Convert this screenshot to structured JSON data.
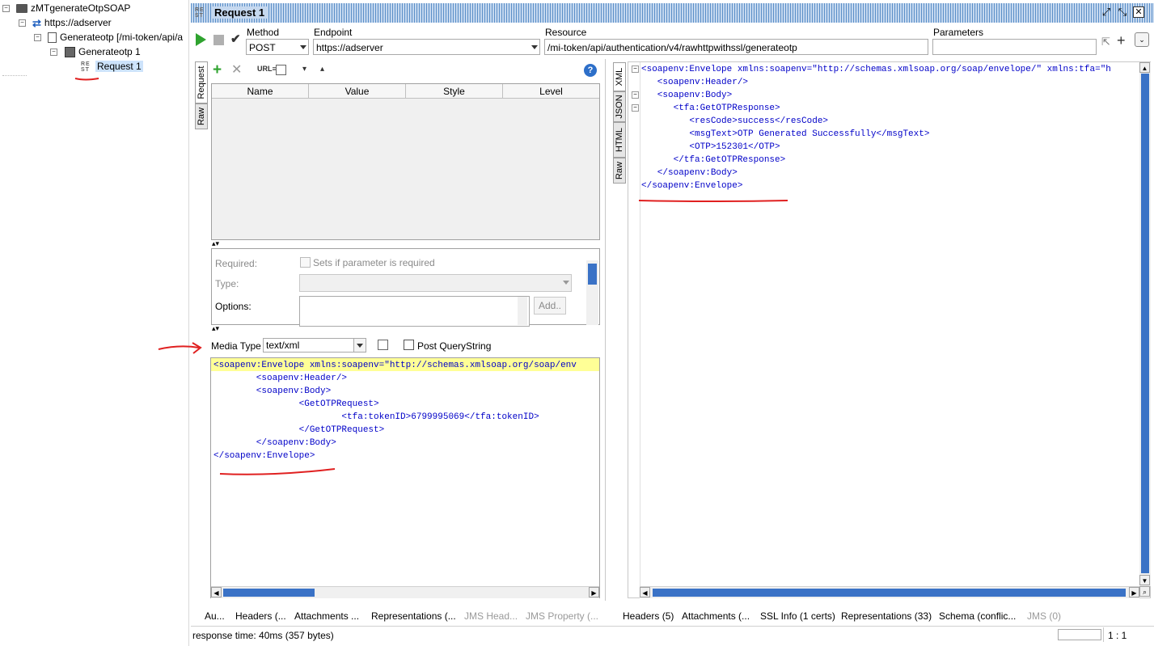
{
  "tree": {
    "project": "zMTgenerateOtpSOAP",
    "service": "https://adserver",
    "resource": "Generateotp [/mi-token/api/a",
    "method": "Generateotp 1",
    "request": "Request 1"
  },
  "window": {
    "icon_text": "RE ST",
    "title": "Request 1"
  },
  "toolbar": {
    "method_label": "Method",
    "method_value": "POST",
    "endpoint_label": "Endpoint",
    "endpoint_value": "https://adserver",
    "resource_label": "Resource",
    "resource_value": "/mi-token/api/authentication/v4/rawhttpwithssl/generateotp",
    "parameters_label": "Parameters",
    "parameters_value": ""
  },
  "request_panel": {
    "tabs": [
      "Request",
      "Raw"
    ],
    "columns": [
      "Name",
      "Value",
      "Style",
      "Level"
    ],
    "required_label": "Required:",
    "required_checkbox_label": "Sets if parameter is required",
    "type_label": "Type:",
    "options_label": "Options:",
    "add_button": "Add..",
    "media_type_label": "Media Type",
    "media_type_value": "text/xml",
    "post_querystring_label": "Post QueryString",
    "bottom_tabs": [
      "Au...",
      "Headers (...",
      "Attachments ...",
      "Representations (...",
      "JMS Head...",
      "JMS Property (..."
    ]
  },
  "request_xml": [
    "<soapenv:Envelope xmlns:soapenv=\"http://schemas.xmlsoap.org/soap/env",
    "        <soapenv:Header/>",
    "        <soapenv:Body>",
    "                <GetOTPRequest>",
    "                        <tfa:tokenID>6799995069</tfa:tokenID>",
    "                </GetOTPRequest>",
    "        </soapenv:Body>",
    "</soapenv:Envelope>"
  ],
  "response_panel": {
    "tabs": [
      "XML",
      "JSON",
      "HTML",
      "Raw"
    ],
    "bottom_tabs": [
      "Headers (5)",
      "Attachments (...",
      "SSL Info (1 certs)",
      "Representations (33)",
      "Schema (conflic...",
      "JMS (0)"
    ]
  },
  "response_xml": [
    "<soapenv:Envelope xmlns:soapenv=\"http://schemas.xmlsoap.org/soap/envelope/\" xmlns:tfa=\"h",
    "   <soapenv:Header/>",
    "   <soapenv:Body>",
    "      <tfa:GetOTPResponse>",
    "         <resCode>success</resCode>",
    "         <msgText>OTP Generated Successfully</msgText>",
    "         <OTP>152301</OTP>",
    "      </tfa:GetOTPResponse>",
    "   </soapenv:Body>",
    "</soapenv:Envelope>"
  ],
  "status": {
    "response_time": "response time: 40ms (357 bytes)",
    "position": "1 : 1"
  },
  "colors": {
    "annotation": "#e02020",
    "scroll_thumb": "#3a72c6",
    "xml_tag": "#0000c8",
    "xml_attr_value": "#2a00ff"
  }
}
